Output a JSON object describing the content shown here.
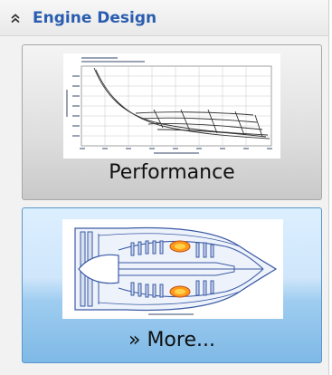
{
  "section": {
    "title": "Engine Design",
    "collapse_icon": "chevron-double-up-icon"
  },
  "tiles": [
    {
      "label": "Performance",
      "thumbnail_icon": "performance-chart-thumbnail"
    },
    {
      "label": "» More...",
      "thumbnail_icon": "engine-cross-section-thumbnail"
    }
  ],
  "colors": {
    "title": "#2a5db0",
    "selected_tile": "#7eb9e6",
    "normal_tile": "#dedede"
  }
}
